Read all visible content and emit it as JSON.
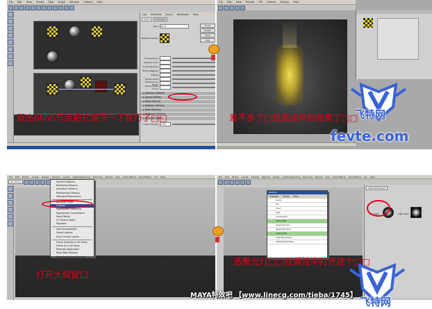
{
  "quadrants": {
    "top_left": {
      "caption": "双击blinn节点把它调节一下就行了□□",
      "menubar": [
        "File",
        "Edit",
        "View",
        "Create",
        "Tabs",
        "Graph",
        "Window",
        "Options",
        "Help"
      ],
      "attr_menubar": [
        "List",
        "Selected",
        "Focus",
        "Attributes",
        "Help"
      ],
      "attr_tabs": [
        "blinn1",
        "blinn1SG"
      ],
      "attr_name_label": "blinn",
      "attr_name_value": "blinn1",
      "attr_buttons": [
        "Focus",
        "Presets",
        "Show",
        "Hide"
      ],
      "attr_swatch_label": "Material Sample",
      "attr_rows": [
        "Transparency",
        "Ambient Color",
        "Incandescence",
        "Bump Mapping",
        "Diffuse",
        "Translucence",
        "Translucence Depth",
        "Translucence Focus"
      ],
      "attr_sections": [
        "Specular Shading",
        "Special Effects",
        "Matte Opacity",
        "Raytrace Options",
        "Node Behavior",
        "Hardware Shading",
        "Extra Attributes"
      ],
      "glow_label": "Glow Intensity",
      "glow_value": "0.200"
    },
    "top_right": {
      "caption": "差不多了□就是这样的效果了□□",
      "menubar": [
        "File",
        "Edit",
        "View",
        "Render",
        "IPR",
        "Options",
        "Display",
        "Help"
      ]
    },
    "bottom_left": {
      "caption": "打开大纲窗口",
      "menubar": [
        "File",
        "Edit",
        "Modify",
        "Create",
        "Display",
        "Window",
        "Assets",
        "Lighting/Shading",
        "Texturing",
        "Render",
        "Toon",
        "Paint Effects",
        "Fluid Effects",
        "Fur",
        "Help"
      ],
      "mode_label": "Rendering",
      "window_menu_items": [
        "General Editors",
        "Rendering Editors",
        "Animation Editors",
        "Relationship Editors",
        "Settings/Preferences",
        "Attribute Editor",
        "Outliner",
        "Hypergraph: Hierarchy",
        "Hypergraph: Connections",
        "Paint Effects",
        "UV Texture Editor",
        "Playblast",
        "View Arrangement",
        "Saved Layouts",
        "Save Current Layout...",
        "Frame Selection in All Views",
        "Frame All in All Views",
        "Minimize Application",
        "Raise Main Window",
        "Raise Application Windows"
      ]
    },
    "bottom_right": {
      "caption": "选聚光灯□□在属性中打开这个□□",
      "outliner_title": "Outliner",
      "outliner_menu": [
        "Display",
        "Show",
        "Help"
      ],
      "outliner_items": [
        "persp",
        "top",
        "front",
        "side",
        "pointLight1",
        "spotLight1",
        "glassCylinder",
        "glassCylinder1",
        "spotLight2",
        "defaultLightSet",
        "defaultObjectSet"
      ],
      "attr_tab": "spotLightShape1",
      "attr_fields": [
        "Spot Light",
        "Light Glow"
      ],
      "footer_text": "MAYA特效吧 【www.linecg.com/tieba/1745】"
    }
  },
  "watermark": {
    "site_name": "飞特网",
    "url": "fevte.com"
  },
  "colors": {
    "caption": "#e2001a",
    "viewport_dark": "#1c1c1c",
    "maya_gray": "#c8c8c8",
    "watermark_blue": "#3a63d6",
    "glow_gold": "#e8c81e"
  }
}
